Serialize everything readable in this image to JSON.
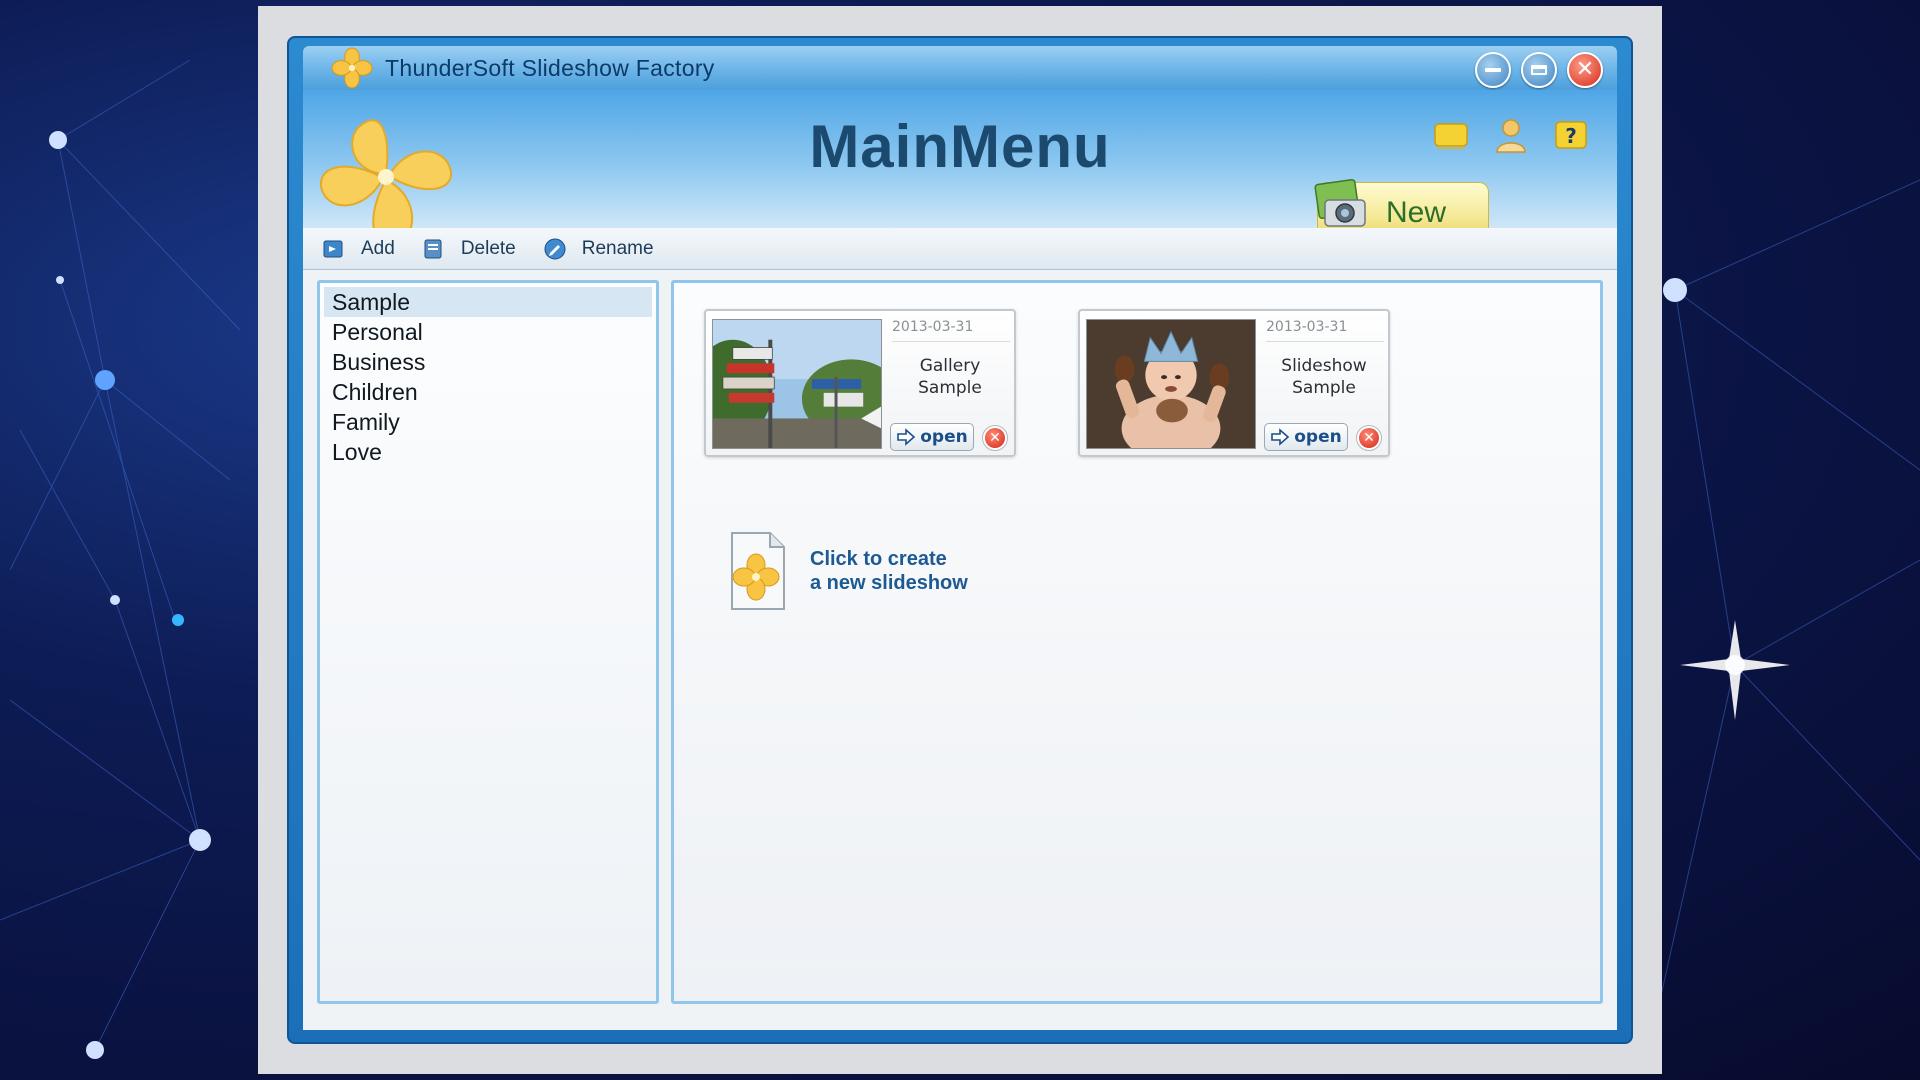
{
  "window": {
    "title": "ThunderSoft Slideshow Factory"
  },
  "header": {
    "title": "MainMenu",
    "new_tab_label": "New"
  },
  "toolbar": {
    "add_label": "Add",
    "delete_label": "Delete",
    "rename_label": "Rename"
  },
  "categories": [
    {
      "label": "Sample",
      "selected": true
    },
    {
      "label": "Personal",
      "selected": false
    },
    {
      "label": "Business",
      "selected": false
    },
    {
      "label": "Children",
      "selected": false
    },
    {
      "label": "Family",
      "selected": false
    },
    {
      "label": "Love",
      "selected": false
    }
  ],
  "projects": [
    {
      "date": "2013-03-31",
      "name": "Gallery\nSample",
      "open_label": "open",
      "thumbnail": "street-signs-photo"
    },
    {
      "date": "2013-03-31",
      "name": "Slideshow\nSample",
      "open_label": "open",
      "thumbnail": "baby-photo"
    }
  ],
  "create_new": {
    "line1": "Click to create",
    "line2": "a new slideshow"
  },
  "colors": {
    "window_blue": "#1b6fb8",
    "accent_yellow": "#f5ea98",
    "link_blue": "#1d5a94",
    "close_red": "#d62b19"
  }
}
